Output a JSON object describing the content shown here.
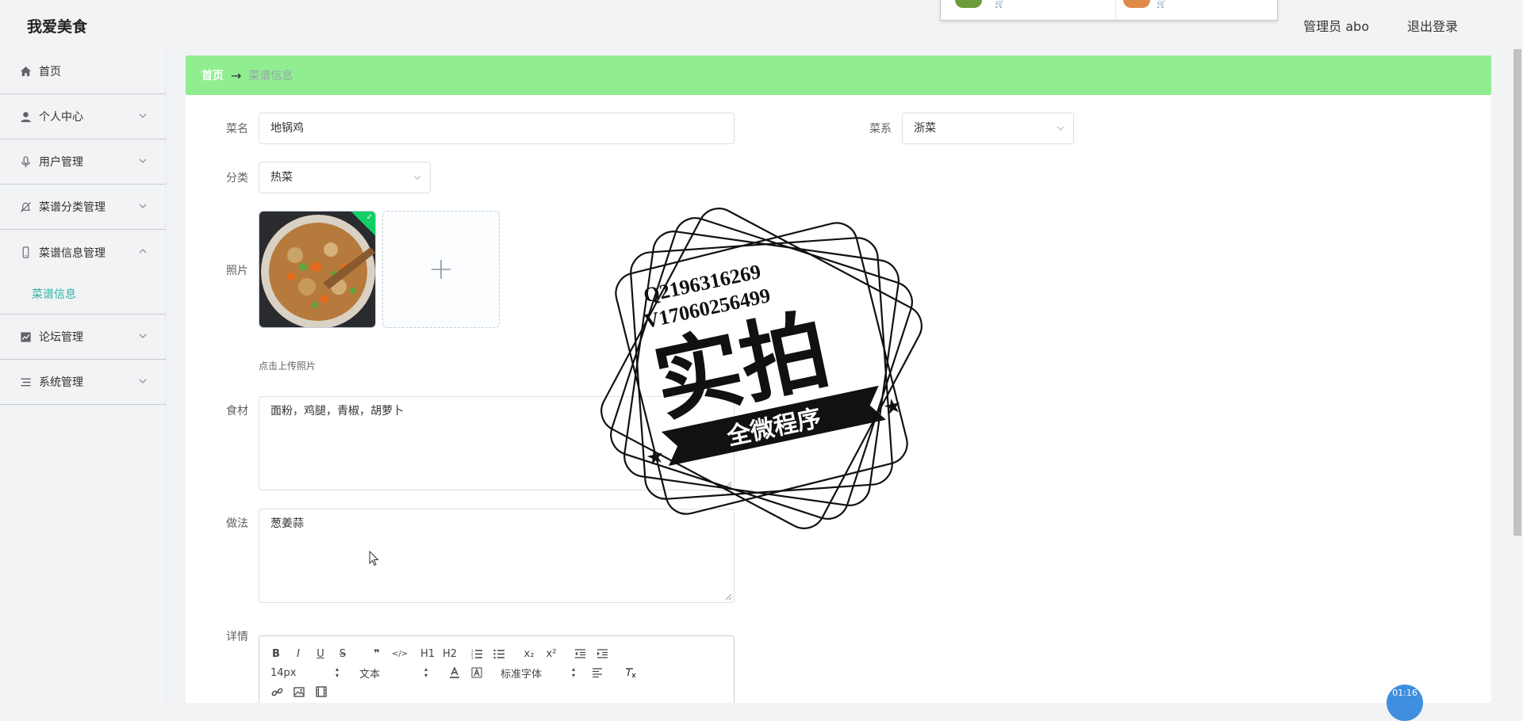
{
  "app": {
    "title": "我爱美食"
  },
  "header": {
    "user_label": "管理员 abo",
    "logout_label": "退出登录"
  },
  "sidebar": {
    "items": [
      {
        "label": "首页",
        "icon": "home-icon"
      },
      {
        "label": "个人中心",
        "icon": "user-icon"
      },
      {
        "label": "用户管理",
        "icon": "microphone-icon"
      },
      {
        "label": "菜谱分类管理",
        "icon": "bell-off-icon"
      },
      {
        "label": "菜谱信息管理",
        "icon": "phone-icon",
        "expanded": true,
        "children": [
          {
            "label": "菜谱信息",
            "active": true
          }
        ]
      },
      {
        "label": "论坛管理",
        "icon": "chart-icon"
      },
      {
        "label": "系统管理",
        "icon": "list-icon"
      }
    ]
  },
  "breadcrumb": {
    "home": "首页",
    "separator": "→",
    "current": "菜谱信息"
  },
  "form": {
    "name": {
      "label": "菜名",
      "value": "地锅鸡"
    },
    "cuisine": {
      "label": "菜系",
      "value": "浙菜"
    },
    "category": {
      "label": "分类",
      "value": "热菜"
    },
    "photo": {
      "label": "照片",
      "tip": "点击上传照片"
    },
    "ingredients": {
      "label": "食材",
      "value": "面粉，鸡腿，青椒，胡萝卜"
    },
    "method": {
      "label": "做法",
      "value": "葱姜蒜"
    },
    "details": {
      "label": "详情"
    }
  },
  "editor": {
    "row1": [
      "B",
      "I",
      "U",
      "S",
      "❞",
      "</>",
      "H1",
      "H2",
      "ol",
      "ul",
      "x₂",
      "x²",
      "outdent",
      "indent"
    ],
    "font_size": "14px",
    "block_type": "文本",
    "font_family": "标准字体",
    "row3": [
      "link",
      "image",
      "video"
    ]
  },
  "watermark": {
    "line1": "Q2196316269",
    "line2": "V17060256499",
    "big": "实拍",
    "banner": "全微程序"
  },
  "floating": {
    "time": "01:16"
  },
  "colors": {
    "breadcrumb_bg": "#90ee90",
    "active_menu": "#2fb5a3",
    "check_badge": "#13ce66",
    "fab": "#3f8ee0"
  }
}
